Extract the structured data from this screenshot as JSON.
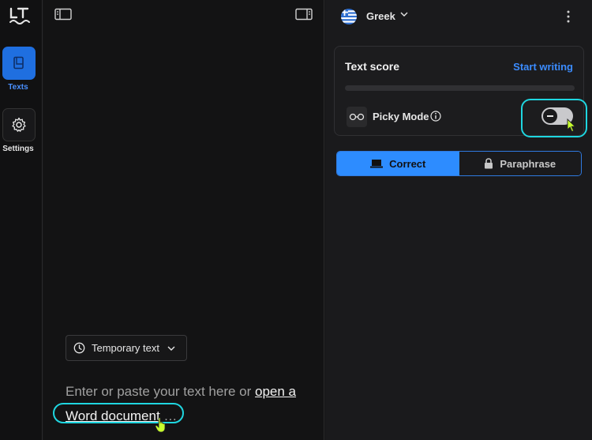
{
  "rail": {
    "logo_text": "LT",
    "texts_label": "Texts",
    "settings_label": "Settings"
  },
  "editor": {
    "temp_button": "Temporary text",
    "placeholder_before": "Enter or paste your text here or ",
    "placeholder_link": "open a Word document",
    "placeholder_after": " …"
  },
  "panel": {
    "language": "Greek",
    "score": {
      "title": "Text score",
      "action": "Start writing",
      "progress": 0
    },
    "picky": {
      "label": "Picky Mode",
      "enabled": false
    },
    "tabs": [
      {
        "label": "Correct",
        "active": true,
        "icon": "laptop-icon"
      },
      {
        "label": "Paraphrase",
        "active": false,
        "icon": "lock-icon"
      }
    ]
  },
  "colors": {
    "accent": "#2d8cff",
    "highlight": "#1fd6e0",
    "cursor": "#c7ff2e"
  }
}
